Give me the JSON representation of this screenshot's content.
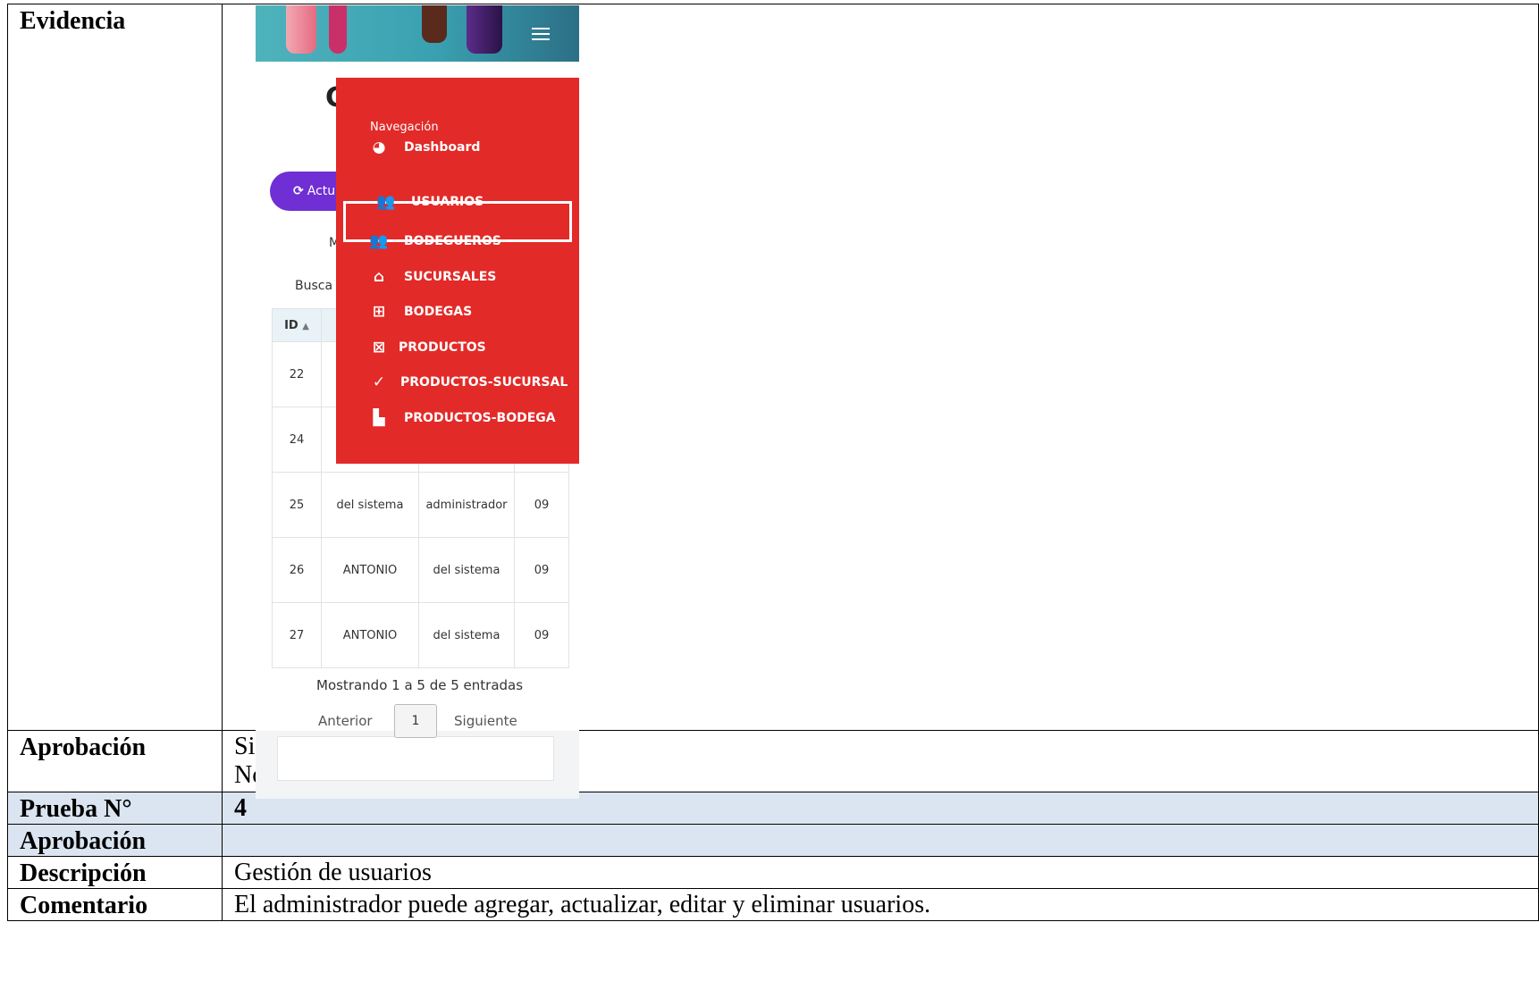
{
  "rows": {
    "evidence": {
      "label": "Evidencia"
    },
    "approval": {
      "label": "Aprobación",
      "yes_line": "Si   ( X )",
      "no_line": "No (      )"
    },
    "test_number": {
      "label": "Prueba N°",
      "value": "4"
    },
    "approval_blank": {
      "label": "Aprobación",
      "value": ""
    },
    "description": {
      "label": "Descripción",
      "value": "Gestión de usuarios"
    },
    "comment": {
      "label": "Comentario",
      "value": "El administrador puede agregar, actualizar, editar y eliminar usuarios."
    }
  },
  "screenshot": {
    "title_partial": "C",
    "refresh_button": "Actu",
    "m_partial": "M",
    "search_label": "Busca",
    "table": {
      "id_header": "ID",
      "rows": [
        {
          "id": "22",
          "c1": "",
          "c2": "",
          "c3": ""
        },
        {
          "id": "24",
          "c1": "",
          "c2": "",
          "c3": ""
        },
        {
          "id": "25",
          "c1": "del sistema",
          "c2": "administrador",
          "c3": "09"
        },
        {
          "id": "26",
          "c1": "ANTONIO",
          "c2": "del sistema",
          "c3": "09"
        },
        {
          "id": "27",
          "c1": "ANTONIO",
          "c2": "del sistema",
          "c3": "09"
        }
      ]
    },
    "info_text": "Mostrando 1 a 5 de 5 entradas",
    "pager": {
      "prev": "Anterior",
      "page": "1",
      "next": "Siguiente"
    },
    "drawer": {
      "heading": "Navegación",
      "items": [
        {
          "label": "Dashboard",
          "icon": "gauge-icon"
        },
        {
          "label": "USUARIOS",
          "icon": "users-icon"
        },
        {
          "label": "BODEGUEROS",
          "icon": "users-icon"
        },
        {
          "label": "SUCURSALES",
          "icon": "home-icon"
        },
        {
          "label": "BODEGAS",
          "icon": "grid-icon"
        },
        {
          "label": "PRODUCTOS",
          "icon": "box-x-icon"
        },
        {
          "label": "PRODUCTOS-SUCURSAL",
          "icon": "check-icon"
        },
        {
          "label": "PRODUCTOS-BODEGA",
          "icon": "warehouse-icon"
        }
      ],
      "active_item": "USUARIOS"
    },
    "colors": {
      "drawer": "#e22a28",
      "button": "#6f2fd4",
      "table_header": "#e9f3f7"
    }
  }
}
